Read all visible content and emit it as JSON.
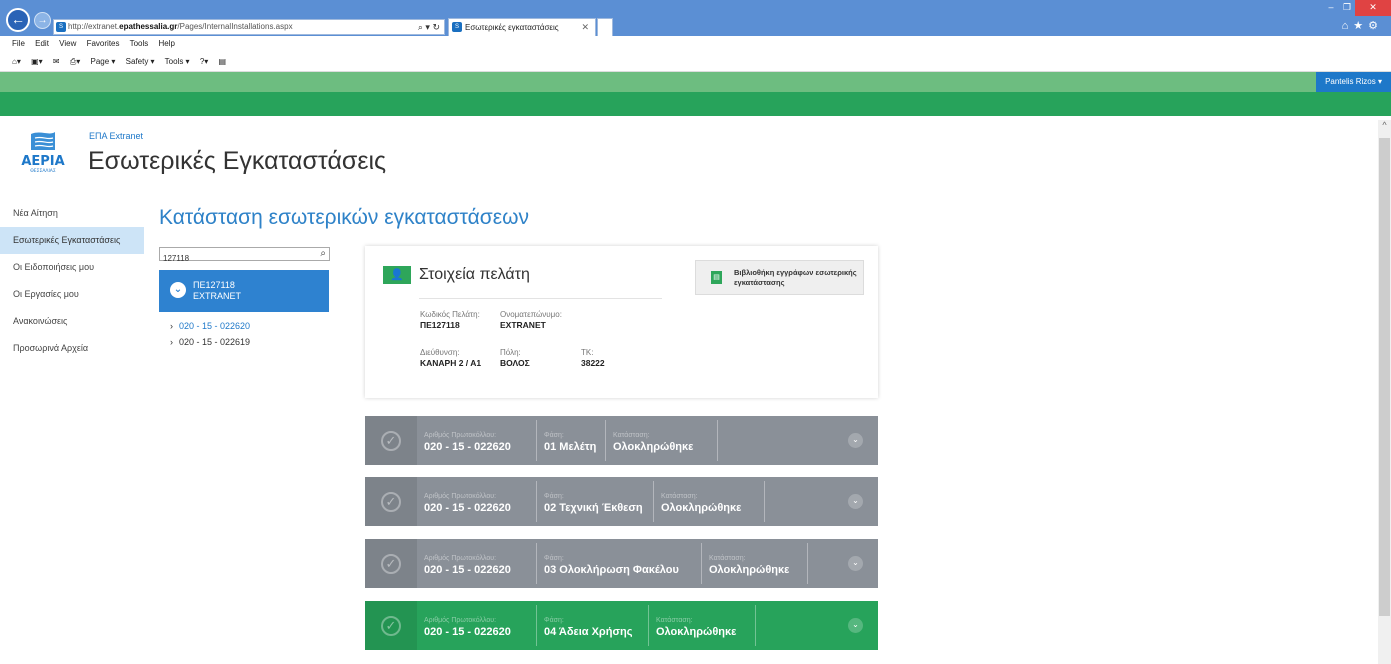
{
  "browser": {
    "url_prefix": "http://extranet.",
    "url_host": "epathessalia.gr",
    "url_path": "/Pages/InternalInstallations.aspx",
    "address_tools": "⌕ ▾ ↻",
    "tab_title": "Εσωτερικές εγκαταστάσεις",
    "menu": [
      "File",
      "Edit",
      "View",
      "Favorites",
      "Tools",
      "Help"
    ],
    "commands": [
      "Page ▾",
      "Safety ▾",
      "Tools ▾"
    ]
  },
  "suite": {
    "user_name": "Pantelis Rizos ▾"
  },
  "header": {
    "site_link": "ΕΠΑ Extranet",
    "page_title": "Εσωτερικές Εγκαταστάσεις",
    "logo_text": "ΑΕΡΙΑ",
    "logo_sub": "ΘΕΣΣΑΛΙΑΣ"
  },
  "sidebar": {
    "items": [
      {
        "label": "Νέα Αίτηση"
      },
      {
        "label": "Εσωτερικές Εγκαταστάσεις"
      },
      {
        "label": "Οι Ειδοποιήσεις μου"
      },
      {
        "label": "Οι Εργασίες μου"
      },
      {
        "label": "Ανακοινώσεις"
      },
      {
        "label": "Προσωρινά Αρχεία"
      }
    ]
  },
  "main": {
    "heading": "Κατάσταση εσωτερικών εγκαταστάσεων",
    "search_value": "127118",
    "selected_customer": {
      "code": "ΠΕ127118",
      "name": "EXTRANET"
    },
    "protocols": [
      {
        "label": "020 - 15 - 022620"
      },
      {
        "label": "020 - 15 - 022619"
      }
    ]
  },
  "customer_panel": {
    "title": "Στοιχεία πελάτη",
    "doc_button": "Βιβλιοθήκη εγγράφων εσωτερικής εγκατάστασης",
    "code_label": "Κωδικός Πελάτη:",
    "code_value": "ΠΕ127118",
    "name_label": "Ονοματεπώνυμο:",
    "name_value": "EXTRANET",
    "address_label": "Διεύθυνση:",
    "address_value": "ΚΑΝΑΡΗ 2 / Α1",
    "city_label": "Πόλη:",
    "city_value": "ΒΟΛΟΣ",
    "zip_label": "ΤΚ:",
    "zip_value": "38222"
  },
  "phases": [
    {
      "protocol_label": "Αριθμός Πρωτοκόλλου:",
      "protocol": "020 - 15 - 022620",
      "phase_label": "Φάση:",
      "phase": "01 Μελέτη",
      "status_label": "Κατάσταση:",
      "status": "Ολοκληρώθηκε"
    },
    {
      "protocol_label": "Αριθμός Πρωτοκόλλου:",
      "protocol": "020 - 15 - 022620",
      "phase_label": "Φάση:",
      "phase": "02 Τεχνική Έκθεση",
      "status_label": "Κατάσταση:",
      "status": "Ολοκληρώθηκε"
    },
    {
      "protocol_label": "Αριθμός Πρωτοκόλλου:",
      "protocol": "020 - 15 - 022620",
      "phase_label": "Φάση:",
      "phase": "03 Ολοκλήρωση Φακέλου",
      "status_label": "Κατάσταση:",
      "status": "Ολοκληρώθηκε"
    },
    {
      "protocol_label": "Αριθμός Πρωτοκόλλου:",
      "protocol": "020 - 15 - 022620",
      "phase_label": "Φάση:",
      "phase": "04 Άδεια Χρήσης",
      "status_label": "Κατάσταση:",
      "status": "Ολοκληρώθηκε"
    }
  ],
  "colors": {
    "accent_blue": "#2e82d0",
    "brand_green": "#27a35b",
    "phase_gray": "#8a9098"
  }
}
